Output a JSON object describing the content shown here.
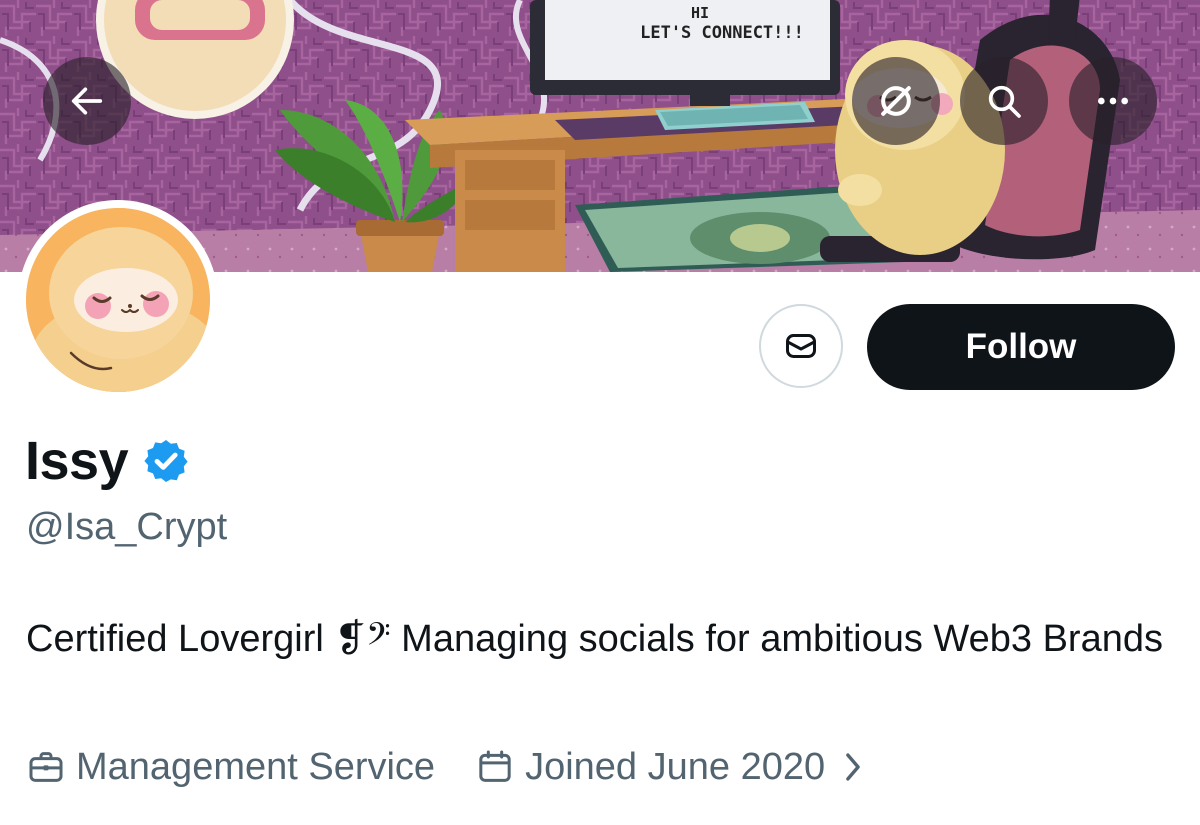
{
  "banner": {
    "monitor_text_line1": "HI",
    "monitor_text_line2": "LET'S CONNECT!!!"
  },
  "top_bar": {
    "back_icon": "arrow-left-icon",
    "grok_icon": "slashed-circle-icon",
    "search_icon": "search-icon",
    "more_icon": "more-horizontal-icon"
  },
  "profile": {
    "display_name": "Issy",
    "handle": "@Isa_Crypt",
    "verified": true,
    "verified_color": "#1d9bf0",
    "bio": "Certified Lovergirl 🎼💞 Managing socials for ambitious Web3 Brands",
    "bio_text": "Certified Lovergirl ❡︎𝄢 Managing socials for ambitious Web3 Brands",
    "category": "Management Service",
    "joined": "Joined June 2020"
  },
  "actions": {
    "message_icon": "envelope-icon",
    "follow_label": "Follow"
  },
  "colors": {
    "primary_text": "#0f1419",
    "secondary_text": "#536471",
    "follow_bg": "#0f1419",
    "banner_purple": "#8a4d86",
    "avatar_orange": "#f8b45e"
  }
}
